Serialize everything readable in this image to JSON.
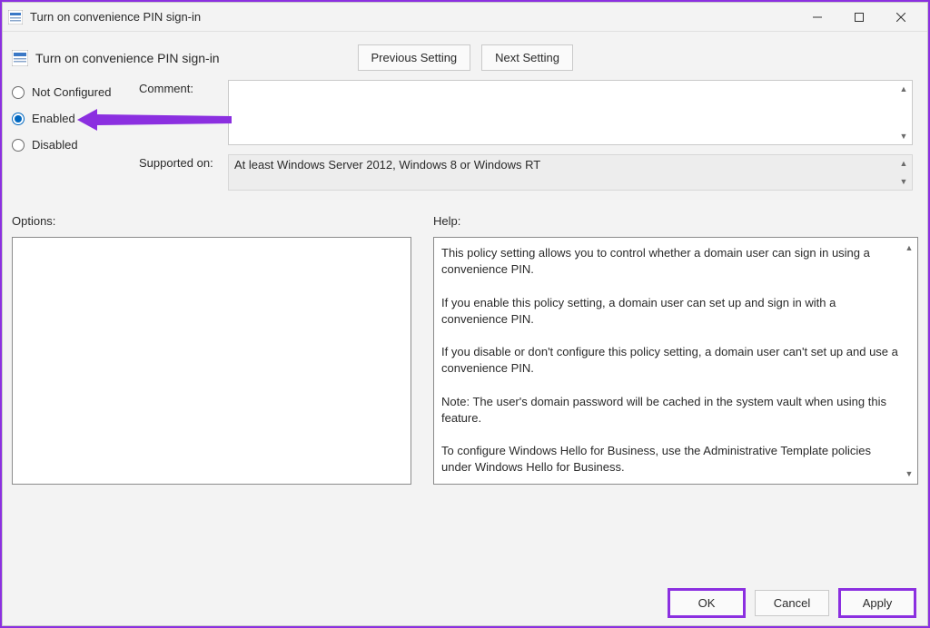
{
  "window": {
    "title": "Turn on convenience PIN sign-in",
    "subtitle": "Turn on convenience PIN sign-in"
  },
  "nav": {
    "previous": "Previous Setting",
    "next": "Next Setting"
  },
  "radios": {
    "not_configured": "Not Configured",
    "enabled": "Enabled",
    "disabled": "Disabled"
  },
  "fields": {
    "comment_label": "Comment:",
    "comment_value": "",
    "supported_label": "Supported on:",
    "supported_value": "At least Windows Server 2012, Windows 8 or Windows RT"
  },
  "panes": {
    "options_label": "Options:",
    "help_label": "Help:",
    "help_text": "This policy setting allows you to control whether a domain user can sign in using a convenience PIN.\n\nIf you enable this policy setting, a domain user can set up and sign in with a convenience PIN.\n\nIf you disable or don't configure this policy setting, a domain user can't set up and use a convenience PIN.\n\nNote: The user's domain password will be cached in the system vault when using this feature.\n\nTo configure Windows Hello for Business, use the Administrative Template policies under Windows Hello for Business."
  },
  "footer": {
    "ok": "OK",
    "cancel": "Cancel",
    "apply": "Apply"
  },
  "colors": {
    "highlight": "#8b2fe0",
    "radio_selected": "#0067c0"
  }
}
